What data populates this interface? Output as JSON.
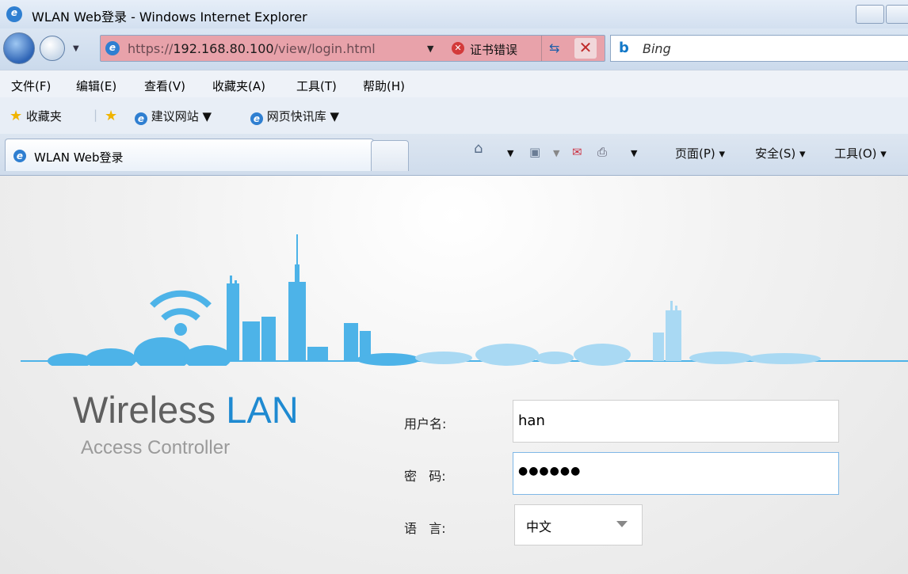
{
  "window": {
    "title": "WLAN Web登录 - Windows Internet Explorer"
  },
  "address_bar": {
    "url_prefix": "https://",
    "url_host": "192.168.80.100",
    "url_path": "/view/login.html",
    "cert_error": "证书错误"
  },
  "search": {
    "placeholder": "Bing"
  },
  "menu": {
    "items": [
      "文件(F)",
      "编辑(E)",
      "查看(V)",
      "收藏夹(A)",
      "工具(T)",
      "帮助(H)"
    ]
  },
  "favorites_bar": {
    "favorites_label": "收藏夹",
    "suggested_sites": "建议网站 ▼",
    "web_slice": "网页快讯库 ▼"
  },
  "tabs": {
    "active_tab": "WLAN Web登录"
  },
  "command_bar": {
    "page": "页面(P) ▾",
    "safety": "安全(S) ▾",
    "tools": "工具(O) ▾"
  },
  "login_page": {
    "brand_line1_a": "Wireless ",
    "brand_line1_b": "LAN",
    "brand_line2": "Access Controller",
    "username_label": "用户名:",
    "username_value": "han",
    "password_label": "密   码:",
    "password_value": "●●●●●●",
    "language_label": "语   言:",
    "language_value": "中文",
    "accent_color": "#4db3e8"
  }
}
